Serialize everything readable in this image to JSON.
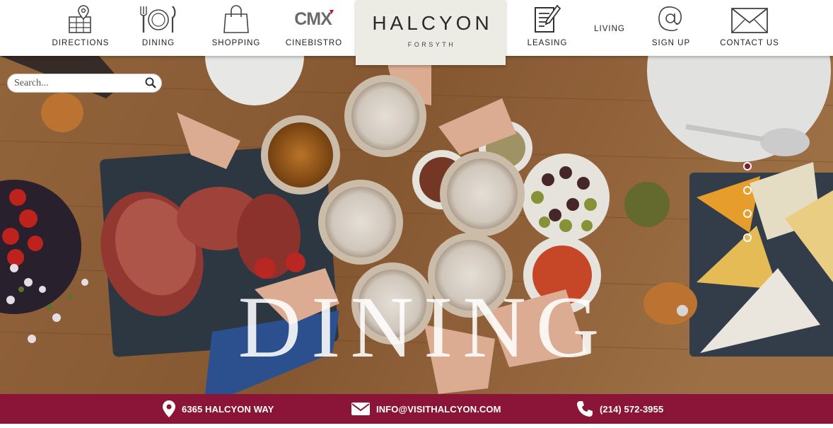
{
  "nav": {
    "items": [
      {
        "label": "DIRECTIONS",
        "icon": "map-pin-icon"
      },
      {
        "label": "DINING",
        "icon": "fork-plate-knife-icon"
      },
      {
        "label": "SHOPPING",
        "icon": "shopping-bag-icon"
      },
      {
        "label": "CINEBISTRO",
        "icon": "cmx-logo-icon"
      },
      {
        "label": "LEASING",
        "icon": "document-pen-icon"
      },
      {
        "label": "LIVING",
        "icon": ""
      },
      {
        "label": "SIGN UP",
        "icon": "at-sign-icon"
      },
      {
        "label": "CONTACT US",
        "icon": "envelope-icon"
      }
    ],
    "cmx_logo_text": "CMX"
  },
  "logo": {
    "main": "HALCYON",
    "sub": "FORSYTH"
  },
  "search": {
    "placeholder": "Search..."
  },
  "hero": {
    "title": "DINING",
    "slides": 4,
    "active_slide": 1
  },
  "footer": {
    "address": "6365 HALCYON WAY",
    "email": "INFO@VISITHALCYON.COM",
    "phone": "(214) 572-3955"
  },
  "colors": {
    "accent": "#8b1538",
    "logo_bg": "#ecebe4"
  }
}
